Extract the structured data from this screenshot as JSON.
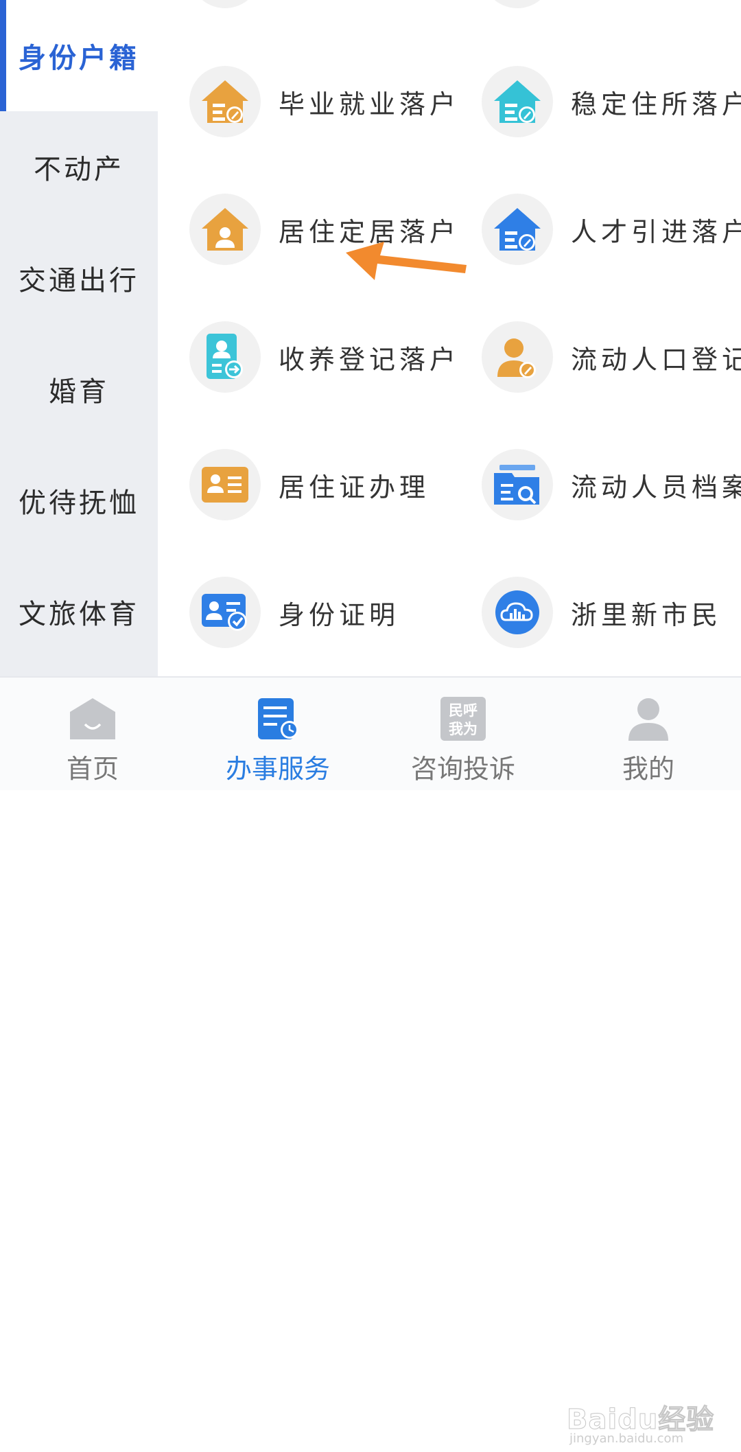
{
  "sidebar": {
    "items": [
      {
        "label": "身份户籍",
        "active": true
      },
      {
        "label": "不动产",
        "active": false
      },
      {
        "label": "交通出行",
        "active": false
      },
      {
        "label": "婚育",
        "active": false
      },
      {
        "label": "优待抚恤",
        "active": false
      },
      {
        "label": "文旅体育",
        "active": false
      }
    ]
  },
  "services": [
    {
      "label": "毕业就业落户",
      "icon": "house-edit-icon",
      "color": "#e8a23f"
    },
    {
      "label": "稳定住所落户",
      "icon": "house-edit-icon",
      "color": "#35c2d6"
    },
    {
      "label": "居住定居落户",
      "icon": "house-person-icon",
      "color": "#e8a23f"
    },
    {
      "label": "人才引进落户",
      "icon": "house-edit-icon",
      "color": "#2f7fe6"
    },
    {
      "label": "收养登记落户",
      "icon": "person-transfer-icon",
      "color": "#3cc4d8"
    },
    {
      "label": "流动人口登记",
      "icon": "person-edit-icon",
      "color": "#e8a23f"
    },
    {
      "label": "居住证办理",
      "icon": "id-card-icon",
      "color": "#e8a23f"
    },
    {
      "label": "流动人员档案",
      "icon": "folder-search-icon",
      "color": "#2f7fe6"
    },
    {
      "label": "身份证明",
      "icon": "id-card-check-icon",
      "color": "#2f7fe6"
    },
    {
      "label": "浙里新市民",
      "icon": "cloud-city-icon",
      "color": "#2f7fe6"
    }
  ],
  "tabbar": {
    "tabs": [
      {
        "label": "首页",
        "icon": "home-icon",
        "active": false
      },
      {
        "label": "办事服务",
        "icon": "service-doc-icon",
        "active": true
      },
      {
        "label": "咨询投诉",
        "icon": "min-hu-wo-wei-icon",
        "icon_text": "民呼我为",
        "active": false
      },
      {
        "label": "我的",
        "icon": "user-icon",
        "active": false
      }
    ]
  },
  "watermark": {
    "text": "Baidu经验",
    "sub": "jingyan.baidu.com"
  },
  "colors": {
    "accent": "#2a63d4",
    "active_tab": "#2a7de1",
    "arrow": "#f28a2e"
  }
}
